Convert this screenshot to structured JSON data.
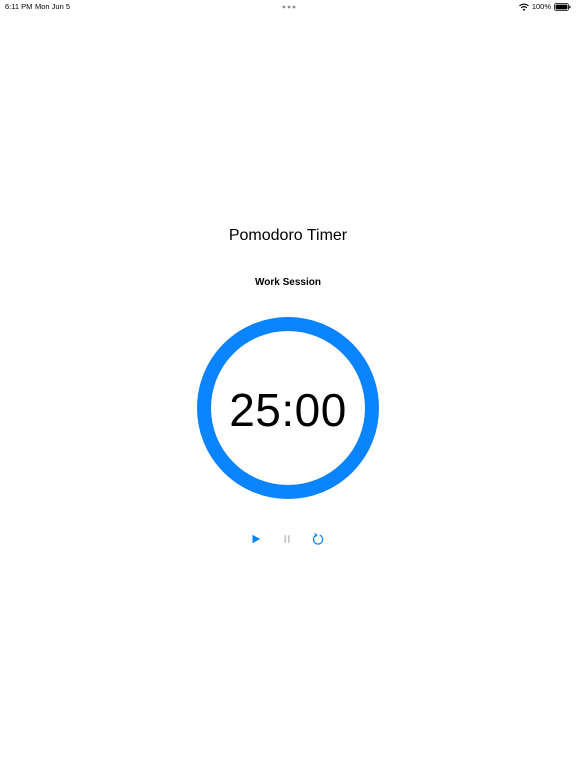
{
  "status_bar": {
    "time": "6:11 PM",
    "date": "Mon Jun 5",
    "battery": "100%",
    "icons": [
      "multitask-dots-icon",
      "wifi-icon",
      "battery-icon"
    ]
  },
  "app": {
    "title": "Pomodoro Timer",
    "session_label": "Work Session",
    "time_remaining": "25:00",
    "progress": 1.0
  },
  "controls": {
    "play": {
      "icon": "play-icon",
      "enabled": true
    },
    "pause": {
      "icon": "pause-icon",
      "enabled": false
    },
    "reset": {
      "icon": "reset-icon",
      "enabled": true
    }
  },
  "colors": {
    "accent": "#0a84ff",
    "disabled": "#c7c7cc",
    "text": "#000000",
    "background": "#ffffff"
  }
}
